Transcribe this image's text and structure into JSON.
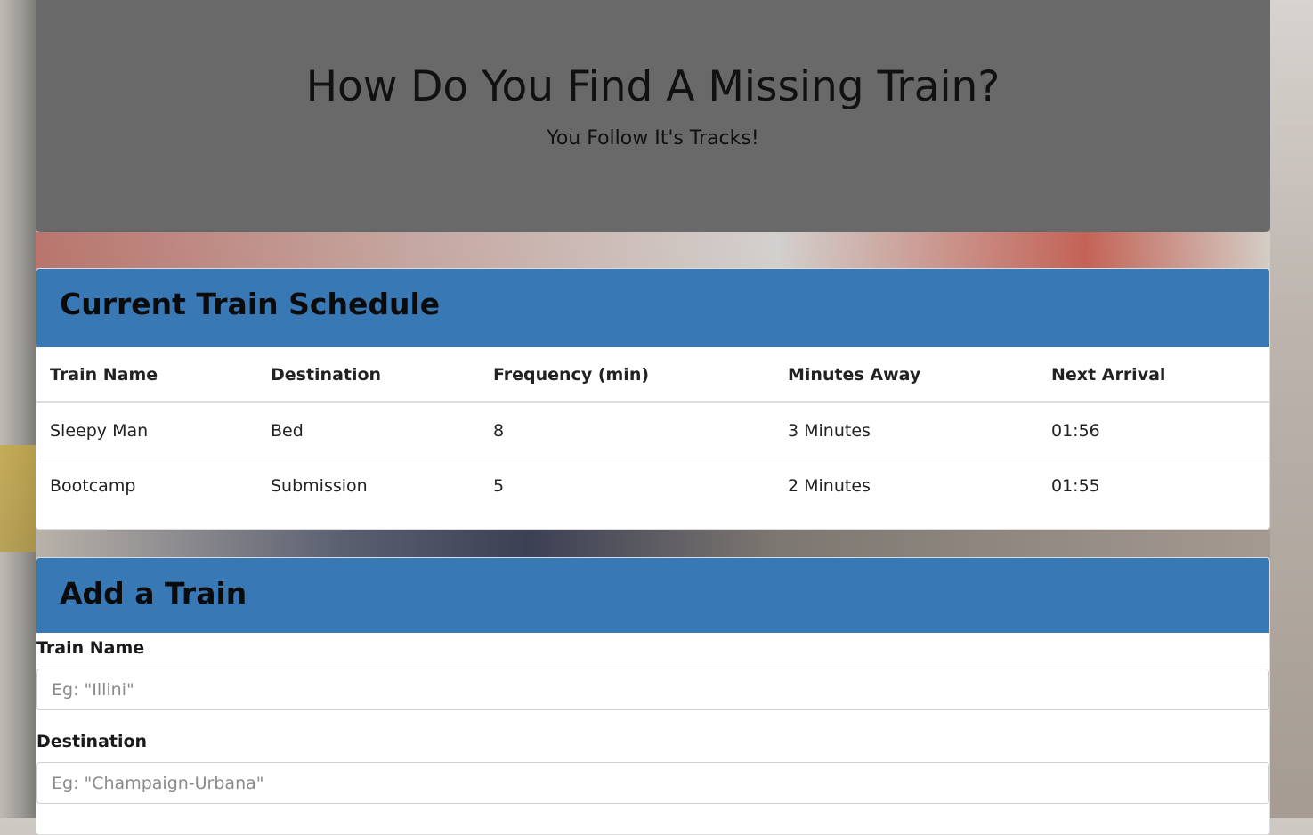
{
  "header": {
    "title": "How Do You Find A Missing Train?",
    "subtitle": "You Follow It's Tracks!"
  },
  "schedule": {
    "heading": "Current Train Schedule",
    "columns": [
      "Train Name",
      "Destination",
      "Frequency (min)",
      "Minutes Away",
      "Next Arrival"
    ],
    "rows": [
      [
        "Sleepy Man",
        "Bed",
        "8",
        "3 Minutes",
        "01:56"
      ],
      [
        "Bootcamp",
        "Submission",
        "5",
        "2 Minutes",
        "01:55"
      ]
    ]
  },
  "add_train": {
    "heading": "Add a Train",
    "train_name_label": "Train Name",
    "train_name_placeholder": "Eg: \"Illini\"",
    "destination_label": "Destination",
    "destination_placeholder": "Eg: \"Champaign-Urbana\""
  },
  "colors": {
    "jumbotron_bg": "#696969",
    "panel_heading_bg": "#3878b4"
  }
}
